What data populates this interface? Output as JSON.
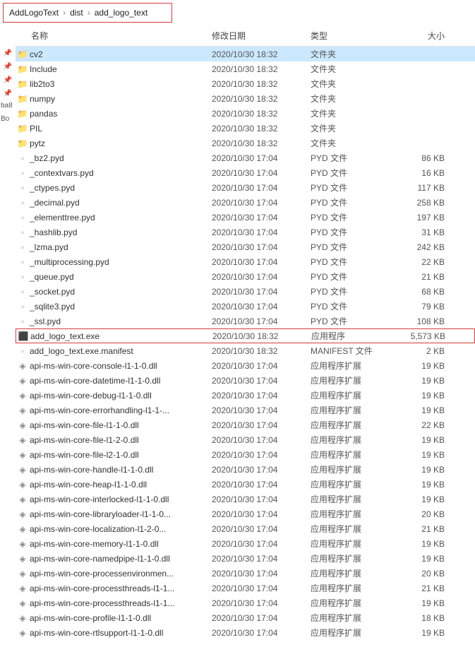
{
  "breadcrumb": [
    "AddLogoText",
    "dist",
    "add_logo_text"
  ],
  "columns": {
    "name": "名称",
    "date": "修改日期",
    "type": "类型",
    "size": "大小"
  },
  "quick": [
    "📌",
    "📌",
    "📌",
    "📌",
    "ba8",
    "",
    "Bo"
  ],
  "files": [
    {
      "icon": "folder",
      "name": "cv2",
      "date": "2020/10/30 18:32",
      "type": "文件夹",
      "size": "",
      "selected": true
    },
    {
      "icon": "folder",
      "name": "Include",
      "date": "2020/10/30 18:32",
      "type": "文件夹",
      "size": ""
    },
    {
      "icon": "folder",
      "name": "lib2to3",
      "date": "2020/10/30 18:32",
      "type": "文件夹",
      "size": ""
    },
    {
      "icon": "folder",
      "name": "numpy",
      "date": "2020/10/30 18:32",
      "type": "文件夹",
      "size": ""
    },
    {
      "icon": "folder",
      "name": "pandas",
      "date": "2020/10/30 18:32",
      "type": "文件夹",
      "size": ""
    },
    {
      "icon": "folder",
      "name": "PIL",
      "date": "2020/10/30 18:32",
      "type": "文件夹",
      "size": ""
    },
    {
      "icon": "folder",
      "name": "pytz",
      "date": "2020/10/30 18:32",
      "type": "文件夹",
      "size": ""
    },
    {
      "icon": "file",
      "name": "_bz2.pyd",
      "date": "2020/10/30 17:04",
      "type": "PYD 文件",
      "size": "86 KB"
    },
    {
      "icon": "file",
      "name": "_contextvars.pyd",
      "date": "2020/10/30 17:04",
      "type": "PYD 文件",
      "size": "16 KB"
    },
    {
      "icon": "file",
      "name": "_ctypes.pyd",
      "date": "2020/10/30 17:04",
      "type": "PYD 文件",
      "size": "117 KB"
    },
    {
      "icon": "file",
      "name": "_decimal.pyd",
      "date": "2020/10/30 17:04",
      "type": "PYD 文件",
      "size": "258 KB"
    },
    {
      "icon": "file",
      "name": "_elementtree.pyd",
      "date": "2020/10/30 17:04",
      "type": "PYD 文件",
      "size": "197 KB"
    },
    {
      "icon": "file",
      "name": "_hashlib.pyd",
      "date": "2020/10/30 17:04",
      "type": "PYD 文件",
      "size": "31 KB"
    },
    {
      "icon": "file",
      "name": "_lzma.pyd",
      "date": "2020/10/30 17:04",
      "type": "PYD 文件",
      "size": "242 KB"
    },
    {
      "icon": "file",
      "name": "_multiprocessing.pyd",
      "date": "2020/10/30 17:04",
      "type": "PYD 文件",
      "size": "22 KB"
    },
    {
      "icon": "file",
      "name": "_queue.pyd",
      "date": "2020/10/30 17:04",
      "type": "PYD 文件",
      "size": "21 KB"
    },
    {
      "icon": "file",
      "name": "_socket.pyd",
      "date": "2020/10/30 17:04",
      "type": "PYD 文件",
      "size": "68 KB"
    },
    {
      "icon": "file",
      "name": "_sqlite3.pyd",
      "date": "2020/10/30 17:04",
      "type": "PYD 文件",
      "size": "79 KB"
    },
    {
      "icon": "file",
      "name": "_ssl.pyd",
      "date": "2020/10/30 17:04",
      "type": "PYD 文件",
      "size": "108 KB"
    },
    {
      "icon": "exe",
      "name": "add_logo_text.exe",
      "date": "2020/10/30 18:32",
      "type": "应用程序",
      "size": "5,573 KB",
      "highlighted": true
    },
    {
      "icon": "file",
      "name": "add_logo_text.exe.manifest",
      "date": "2020/10/30 18:32",
      "type": "MANIFEST 文件",
      "size": "2 KB"
    },
    {
      "icon": "dll",
      "name": "api-ms-win-core-console-l1-1-0.dll",
      "date": "2020/10/30 17:04",
      "type": "应用程序扩展",
      "size": "19 KB"
    },
    {
      "icon": "dll",
      "name": "api-ms-win-core-datetime-l1-1-0.dll",
      "date": "2020/10/30 17:04",
      "type": "应用程序扩展",
      "size": "19 KB"
    },
    {
      "icon": "dll",
      "name": "api-ms-win-core-debug-l1-1-0.dll",
      "date": "2020/10/30 17:04",
      "type": "应用程序扩展",
      "size": "19 KB"
    },
    {
      "icon": "dll",
      "name": "api-ms-win-core-errorhandling-l1-1-...",
      "date": "2020/10/30 17:04",
      "type": "应用程序扩展",
      "size": "19 KB"
    },
    {
      "icon": "dll",
      "name": "api-ms-win-core-file-l1-1-0.dll",
      "date": "2020/10/30 17:04",
      "type": "应用程序扩展",
      "size": "22 KB"
    },
    {
      "icon": "dll",
      "name": "api-ms-win-core-file-l1-2-0.dll",
      "date": "2020/10/30 17:04",
      "type": "应用程序扩展",
      "size": "19 KB"
    },
    {
      "icon": "dll",
      "name": "api-ms-win-core-file-l2-1-0.dll",
      "date": "2020/10/30 17:04",
      "type": "应用程序扩展",
      "size": "19 KB"
    },
    {
      "icon": "dll",
      "name": "api-ms-win-core-handle-l1-1-0.dll",
      "date": "2020/10/30 17:04",
      "type": "应用程序扩展",
      "size": "19 KB"
    },
    {
      "icon": "dll",
      "name": "api-ms-win-core-heap-l1-1-0.dll",
      "date": "2020/10/30 17:04",
      "type": "应用程序扩展",
      "size": "19 KB"
    },
    {
      "icon": "dll",
      "name": "api-ms-win-core-interlocked-l1-1-0.dll",
      "date": "2020/10/30 17:04",
      "type": "应用程序扩展",
      "size": "19 KB"
    },
    {
      "icon": "dll",
      "name": "api-ms-win-core-libraryloader-l1-1-0...",
      "date": "2020/10/30 17:04",
      "type": "应用程序扩展",
      "size": "20 KB"
    },
    {
      "icon": "dll",
      "name": "api-ms-win-core-localization-l1-2-0...",
      "date": "2020/10/30 17:04",
      "type": "应用程序扩展",
      "size": "21 KB"
    },
    {
      "icon": "dll",
      "name": "api-ms-win-core-memory-l1-1-0.dll",
      "date": "2020/10/30 17:04",
      "type": "应用程序扩展",
      "size": "19 KB"
    },
    {
      "icon": "dll",
      "name": "api-ms-win-core-namedpipe-l1-1-0.dll",
      "date": "2020/10/30 17:04",
      "type": "应用程序扩展",
      "size": "19 KB"
    },
    {
      "icon": "dll",
      "name": "api-ms-win-core-processenvironmen...",
      "date": "2020/10/30 17:04",
      "type": "应用程序扩展",
      "size": "20 KB"
    },
    {
      "icon": "dll",
      "name": "api-ms-win-core-processthreads-l1-1...",
      "date": "2020/10/30 17:04",
      "type": "应用程序扩展",
      "size": "21 KB"
    },
    {
      "icon": "dll",
      "name": "api-ms-win-core-processthreads-l1-1...",
      "date": "2020/10/30 17:04",
      "type": "应用程序扩展",
      "size": "19 KB"
    },
    {
      "icon": "dll",
      "name": "api-ms-win-core-profile-l1-1-0.dll",
      "date": "2020/10/30 17:04",
      "type": "应用程序扩展",
      "size": "18 KB"
    },
    {
      "icon": "dll",
      "name": "api-ms-win-core-rtlsupport-l1-1-0.dll",
      "date": "2020/10/30 17:04",
      "type": "应用程序扩展",
      "size": "19 KB"
    }
  ],
  "icons": {
    "folder": "📁",
    "file": "▫",
    "exe": "⬛",
    "dll": "◈"
  }
}
